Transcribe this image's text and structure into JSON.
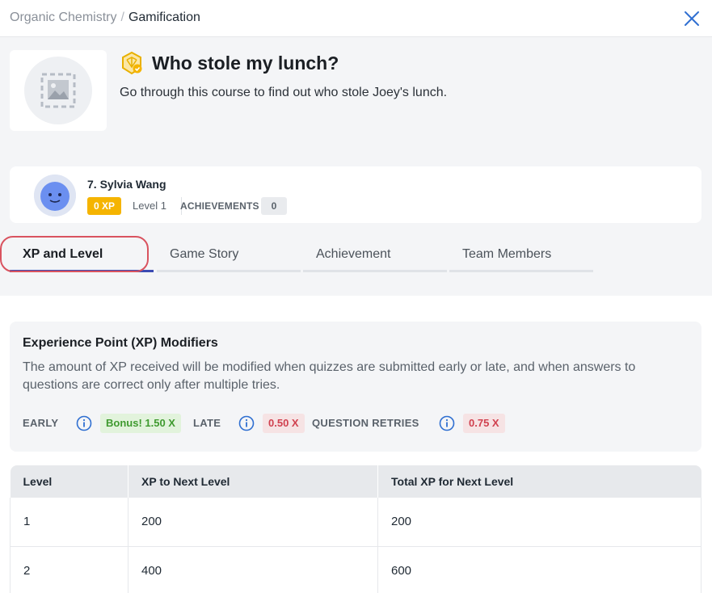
{
  "breadcrumb": {
    "parent": "Organic Chemistry",
    "separator": "/",
    "current": "Gamification"
  },
  "icons": {
    "close": "close-icon",
    "course": "badge-icon",
    "image_placeholder": "image-placeholder-icon",
    "info": "info-icon"
  },
  "course": {
    "title": "Who stole my lunch?",
    "description": "Go through this course to find out who stole Joey's lunch."
  },
  "user": {
    "name": "7. Sylvia Wang",
    "xp": "0 XP",
    "level": "Level 1",
    "achievements_label": "ACHIEVEMENTS",
    "achievements_count": "0"
  },
  "tabs": [
    {
      "label": "XP and Level",
      "active": true
    },
    {
      "label": "Game Story",
      "active": false
    },
    {
      "label": "Achievement",
      "active": false
    },
    {
      "label": "Team Members",
      "active": false
    }
  ],
  "modifiers": {
    "title": "Experience Point (XP) Modifiers",
    "description": "The amount of XP received will be modified when quizzes are submitted early or late, and when answers to questions are correct only after multiple tries.",
    "early_label": "EARLY",
    "early_value": "Bonus! 1.50 X",
    "late_label": "LATE",
    "late_value": "0.50 X",
    "retries_label": "QUESTION RETRIES",
    "retries_value": "0.75 X"
  },
  "table": {
    "headers": [
      "Level",
      "XP to Next Level",
      "Total XP for Next Level"
    ],
    "rows": [
      [
        "1",
        "200",
        "200"
      ],
      [
        "2",
        "400",
        "600"
      ]
    ]
  },
  "colors": {
    "xp_badge": "#f5b400",
    "active_tab_underline": "#3b4bb3",
    "tab_highlight": "#d9535f",
    "bonus_green": "#3f9a2f",
    "penalty_red": "#d0414f",
    "close_blue": "#2f6fd1"
  }
}
